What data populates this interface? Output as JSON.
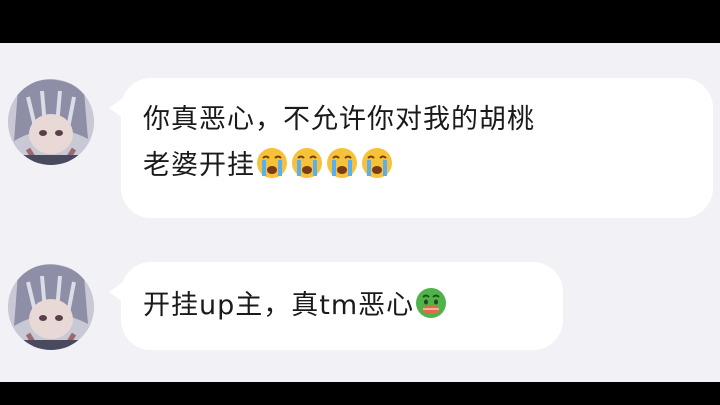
{
  "chat": {
    "messages": [
      {
        "line1": "你真恶心，不允许你对我的胡桃",
        "line2": "老婆开挂",
        "emojis": [
          "loudly-crying-face",
          "loudly-crying-face",
          "loudly-crying-face",
          "loudly-crying-face"
        ]
      },
      {
        "line1": "开挂up主，真tm恶心",
        "emojis": [
          "nauseated-face"
        ]
      }
    ]
  },
  "colors": {
    "chat_background": "#f2f1f6",
    "bubble": "#ffffff",
    "text": "#1a1a1a"
  }
}
